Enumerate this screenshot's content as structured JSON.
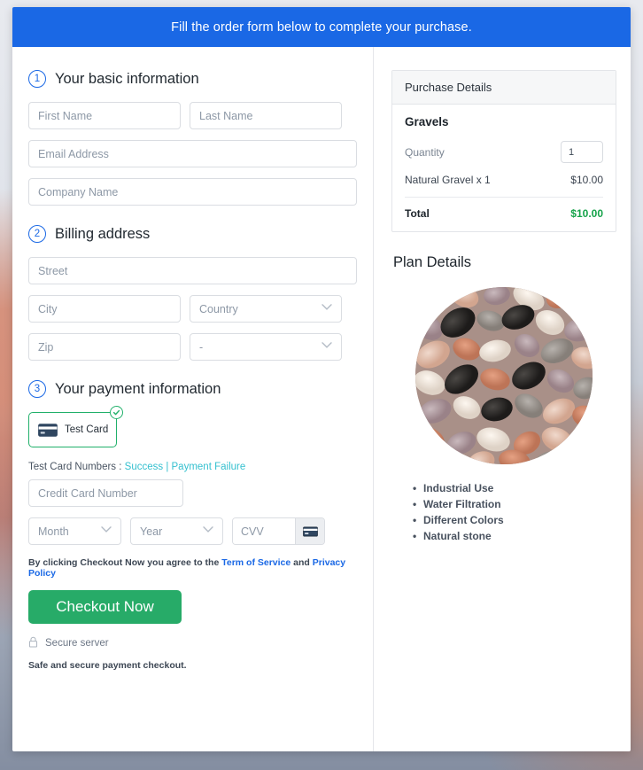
{
  "banner": {
    "text": "Fill the order form below to complete your purchase."
  },
  "colors": {
    "banner_blue": "#1a68e5",
    "accent_green": "#27ab68",
    "total_green": "#16a34a",
    "link_blue": "#1a68e5",
    "link_teal": "#35c0cf",
    "tile_border_green": "#20b06a"
  },
  "steps": [
    {
      "number": "1",
      "title": "Your basic information"
    },
    {
      "number": "2",
      "title": "Billing address"
    },
    {
      "number": "3",
      "title": "Your payment information"
    }
  ],
  "basic_info": {
    "first_name": {
      "placeholder": "First Name",
      "value": ""
    },
    "last_name": {
      "placeholder": "Last Name",
      "value": ""
    },
    "email": {
      "placeholder": "Email Address",
      "value": ""
    },
    "company": {
      "placeholder": "Company Name",
      "value": ""
    }
  },
  "billing": {
    "street": {
      "placeholder": "Street",
      "value": ""
    },
    "city": {
      "placeholder": "City",
      "value": ""
    },
    "country": {
      "selected": "Country"
    },
    "zip": {
      "placeholder": "Zip",
      "value": ""
    },
    "state": {
      "selected": "-"
    }
  },
  "payment": {
    "card_tile": {
      "label": "Test  Card",
      "selected": true,
      "icon": "credit-card-icon",
      "badge_icon": "check-circle-icon"
    },
    "test_numbers": {
      "prefix": "Test Card Numbers : ",
      "success_link": "Success",
      "separator": " | ",
      "failure_link": "Payment Failure"
    },
    "credit_card_number": {
      "placeholder": "Credit Card Number",
      "value": ""
    },
    "month": {
      "selected": "Month"
    },
    "year": {
      "selected": "Year"
    },
    "cvv": {
      "placeholder": "CVV",
      "value": "",
      "icon": "credit-card-icon"
    }
  },
  "agreement": {
    "text_before": "By clicking Checkout Now you agree to the ",
    "terms_link": "Term of Service",
    "text_between": " and ",
    "privacy_link": "Privacy Policy"
  },
  "checkout": {
    "button_label": "Checkout Now"
  },
  "secure": {
    "icon": "lock-icon",
    "label": "Secure server",
    "note": "Safe and secure payment checkout."
  },
  "purchase_details": {
    "header": "Purchase Details",
    "product_name": "Gravels",
    "quantity_label": "Quantity",
    "quantity_value": "1",
    "line_item": {
      "label": "Natural Gravel x 1",
      "amount": "$10.00"
    },
    "total": {
      "label": "Total",
      "amount": "$10.00"
    }
  },
  "plan_details": {
    "title": "Plan Details",
    "image_alt": "gravel-stones-photo",
    "features": [
      "Industrial Use",
      "Water Filtration",
      "Different Colors",
      "Natural stone"
    ]
  }
}
